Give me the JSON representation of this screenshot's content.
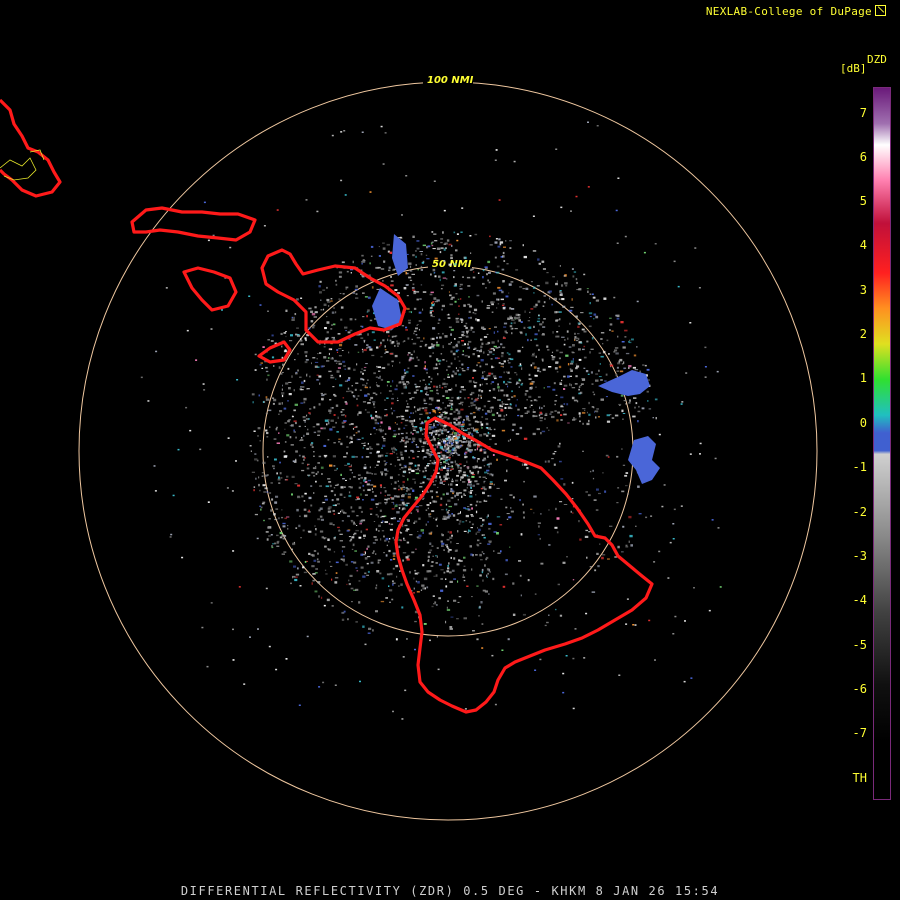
{
  "credit": "NEXLAB-College of DuPage",
  "colorbar": {
    "product": "DZD",
    "unit": "[dB]",
    "ticks": [
      "7",
      "6",
      "5",
      "4",
      "3",
      "2",
      "1",
      "0",
      "-1",
      "-2",
      "-3",
      "-4",
      "-5",
      "-6",
      "-7",
      "TH"
    ]
  },
  "range_rings": [
    {
      "label": "100 NMI",
      "range_nmi": 100
    },
    {
      "label": "50 NMI",
      "range_nmi": 50
    }
  ],
  "caption": "DIFFERENTIAL REFLECTIVITY (ZDR) 0.5 DEG - KHKM 8 JAN 26 15:54",
  "colors": {
    "coastline": "#ff1a1a",
    "county_lines": "#e8e82a",
    "ring": "#f0c8a0",
    "labels": "#ffff33"
  }
}
